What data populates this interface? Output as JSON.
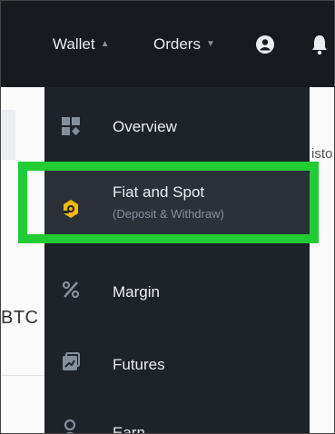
{
  "nav": {
    "wallet_label": "Wallet",
    "orders_label": "Orders",
    "wallet_caret": "▲",
    "orders_caret": "▼",
    "user_icon": "user-circle-icon",
    "bell_icon": "bell-icon"
  },
  "background": {
    "right_text": "isto",
    "left_text": "BTC"
  },
  "menu": {
    "items": [
      {
        "label": "Overview",
        "icon": "grid-icon"
      },
      {
        "label": "Fiat and Spot",
        "sublabel": "(Deposit & Withdraw)",
        "icon": "fiat-spot-icon"
      },
      {
        "label": "Margin",
        "icon": "percent-icon"
      },
      {
        "label": "Futures",
        "icon": "futures-icon"
      },
      {
        "label": "Earn",
        "icon": "earn-icon"
      }
    ]
  },
  "colors": {
    "topbar": "#181a20",
    "menu_bg": "#1e2329",
    "active_item": "#2b3139",
    "highlight_border": "#22cc33",
    "brand_yellow": "#f0b90b",
    "text_primary": "#eaecef",
    "text_secondary": "#848e9c"
  }
}
